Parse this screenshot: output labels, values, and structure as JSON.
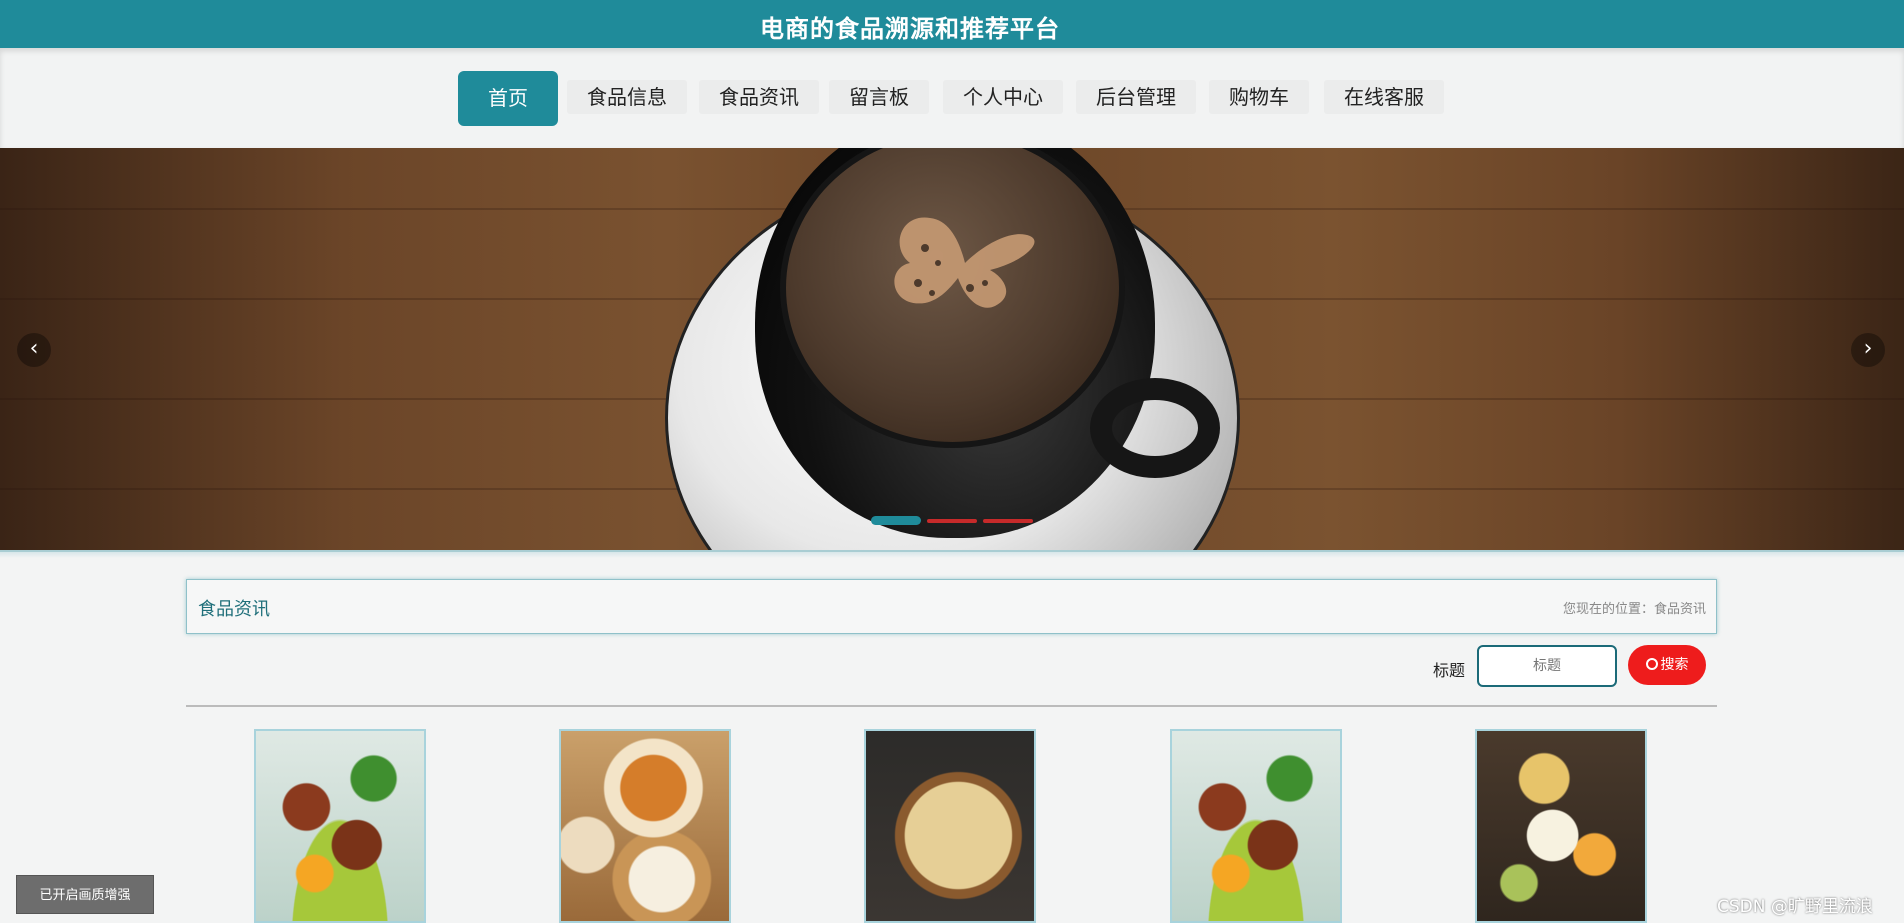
{
  "header": {
    "title": "电商的食品溯源和推荐平台"
  },
  "nav": {
    "items": [
      {
        "label": "首页",
        "active": true
      },
      {
        "label": "食品信息"
      },
      {
        "label": "食品资讯"
      },
      {
        "label": "留言板"
      },
      {
        "label": "个人中心"
      },
      {
        "label": "后台管理"
      },
      {
        "label": "购物车"
      },
      {
        "label": "在线客服"
      }
    ]
  },
  "banner": {
    "prev_icon": "‹",
    "next_icon": "›",
    "slides": 3,
    "active_slide": 1
  },
  "section": {
    "title": "食品资讯",
    "breadcrumb": "您现在的位置：食品资讯"
  },
  "search": {
    "label": "标题",
    "placeholder": "标题",
    "button_label": "搜索"
  },
  "cards": [
    {
      "image": "food-skewers-image"
    },
    {
      "image": "food-dimsum-image"
    },
    {
      "image": "food-cheese-board-image"
    },
    {
      "image": "food-skewers-image"
    },
    {
      "image": "food-cheese-platter-image"
    }
  ],
  "overlay": {
    "quality_label": "已开启画质增强",
    "watermark": "CSDN @旷野里流浪"
  },
  "colors": {
    "primary": "#1f8b9a",
    "search_button": "#ee1c1c",
    "active_dot": "#1f8b9a",
    "inactive_dot": "#c62a2a"
  }
}
